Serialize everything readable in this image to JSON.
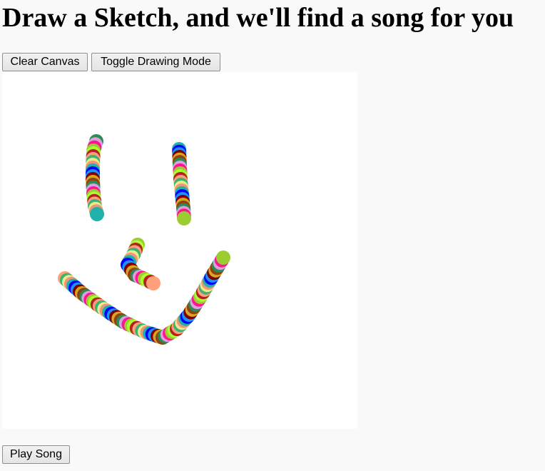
{
  "page": {
    "title": "Draw a Sketch, and we'll find a song for you"
  },
  "toolbar": {
    "clear_label": "Clear Canvas",
    "toggle_label": "Toggle Drawing Mode"
  },
  "footer": {
    "play_label": "Play Song"
  },
  "canvas": {
    "background": "#ffffff"
  },
  "palette": [
    "#2e8b57",
    "#ff69b4",
    "#9acd32",
    "#4682b4",
    "#8b4513",
    "#00ced1",
    "#dda0dd",
    "#228b22",
    "#ffa07a",
    "#6a5acd",
    "#b22222",
    "#ffd700",
    "#1e90ff",
    "#556b2f",
    "#ff1493",
    "#8fbc8f",
    "#d2691e",
    "#483d8b",
    "#20b2aa",
    "#c71585",
    "#adff2f",
    "#00bfff",
    "#800000",
    "#7b68ee",
    "#daa520",
    "#5f9ea0",
    "#e9967a",
    "#9932cc",
    "#3cb371",
    "#ff6347",
    "#0000ff",
    "#708090",
    "#f0e68c",
    "#4b0082"
  ]
}
